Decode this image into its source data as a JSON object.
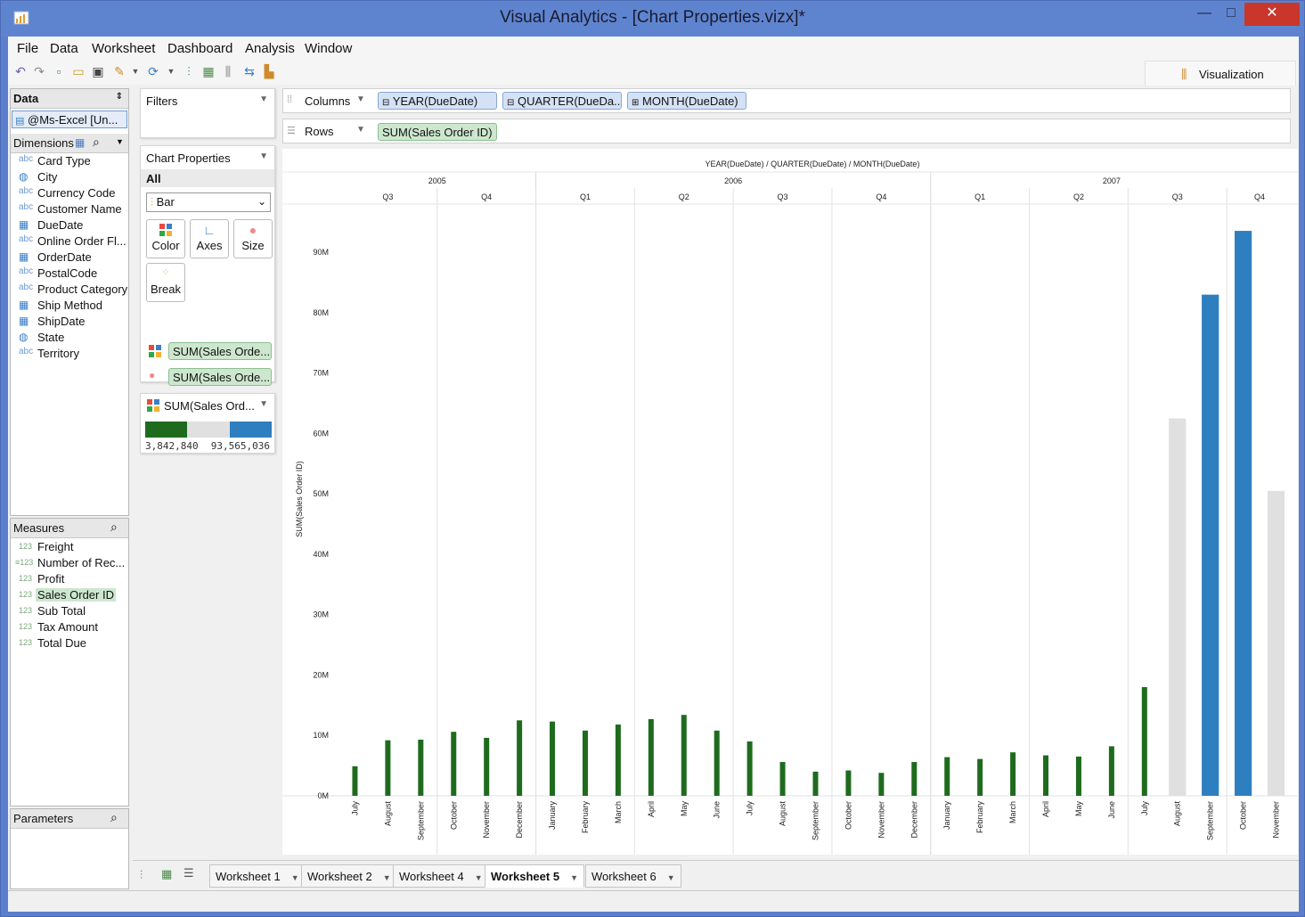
{
  "window": {
    "title": "Visual Analytics - [Chart Properties.vizx]*",
    "min": "—",
    "max": "□",
    "close": "✕"
  },
  "menu": [
    "File",
    "Data",
    "Worksheet",
    "Dashboard",
    "Analysis",
    "Window"
  ],
  "viz_tab": "Visualization",
  "data_panel": {
    "title": "Data",
    "source": "@Ms-Excel [Un...",
    "dimensions_title": "Dimensions",
    "dimensions": [
      {
        "icon": "abc",
        "label": "Card Type"
      },
      {
        "icon": "globe",
        "label": "City"
      },
      {
        "icon": "abc",
        "label": "Currency Code"
      },
      {
        "icon": "abc",
        "label": "Customer Name"
      },
      {
        "icon": "date",
        "label": "DueDate"
      },
      {
        "icon": "abc",
        "label": "Online Order Fl..."
      },
      {
        "icon": "date",
        "label": "OrderDate"
      },
      {
        "icon": "abc",
        "label": "PostalCode"
      },
      {
        "icon": "abc",
        "label": "Product Category"
      },
      {
        "icon": "date",
        "label": "Ship Method"
      },
      {
        "icon": "date",
        "label": "ShipDate"
      },
      {
        "icon": "globe",
        "label": "State"
      },
      {
        "icon": "abc",
        "label": "Territory"
      }
    ],
    "measures_title": "Measures",
    "measures": [
      {
        "icon": "123",
        "label": "Freight"
      },
      {
        "icon": "calc",
        "label": "Number of Rec..."
      },
      {
        "icon": "123",
        "label": "Profit"
      },
      {
        "icon": "123",
        "label": "Sales Order ID",
        "selected": true
      },
      {
        "icon": "123",
        "label": "Sub Total"
      },
      {
        "icon": "123",
        "label": "Tax Amount"
      },
      {
        "icon": "123",
        "label": "Total Due"
      }
    ],
    "parameters_title": "Parameters"
  },
  "filters": {
    "title": "Filters"
  },
  "chart_props": {
    "title": "Chart Properties",
    "all_label": "All",
    "mark_type": "Bar",
    "buttons": {
      "color": "Color",
      "axes": "Axes",
      "size": "Size",
      "break": "Break"
    },
    "pills": [
      "SUM(Sales Orde...",
      "SUM(Sales Orde..."
    ]
  },
  "legend": {
    "title": "SUM(Sales Ord...",
    "min": "3,842,840",
    "max": "93,565,036",
    "colors": [
      "#1e6b1e",
      "#e0e0e0",
      "#2e7fbf"
    ]
  },
  "shelves": {
    "columns_label": "Columns",
    "columns": [
      "YEAR(DueDate)",
      "QUARTER(DueDa...",
      "MONTH(DueDate)"
    ],
    "rows_label": "Rows",
    "rows": [
      "SUM(Sales Order ID)"
    ]
  },
  "sheets": [
    "Worksheet 1",
    "Worksheet 2",
    "Worksheet 4",
    "Worksheet 5",
    "Worksheet 6"
  ],
  "active_sheet": "Worksheet 5",
  "chart_data": {
    "type": "bar",
    "title": "YEAR(DueDate) / QUARTER(DueDate) / MONTH(DueDate)",
    "ylabel": "SUM(Sales Order ID)",
    "ylim": [
      0,
      98000000
    ],
    "yticks": [
      0,
      10000000,
      20000000,
      30000000,
      40000000,
      50000000,
      60000000,
      70000000,
      80000000,
      90000000
    ],
    "ytick_labels": [
      "0M",
      "10M",
      "20M",
      "30M",
      "40M",
      "50M",
      "60M",
      "70M",
      "80M",
      "90M"
    ],
    "years": [
      {
        "label": "2005",
        "span": 6
      },
      {
        "label": "2006",
        "span": 12
      },
      {
        "label": "2007",
        "span": 11
      }
    ],
    "quarters": [
      {
        "label": "Q3",
        "span": 3
      },
      {
        "label": "Q4",
        "span": 3
      },
      {
        "label": "Q1",
        "span": 3
      },
      {
        "label": "Q2",
        "span": 3
      },
      {
        "label": "Q3",
        "span": 3
      },
      {
        "label": "Q4",
        "span": 3
      },
      {
        "label": "Q1",
        "span": 3
      },
      {
        "label": "Q2",
        "span": 3
      },
      {
        "label": "Q3",
        "span": 3
      },
      {
        "label": "Q4",
        "span": 2
      }
    ],
    "categories": [
      "July",
      "August",
      "September",
      "October",
      "November",
      "December",
      "January",
      "February",
      "March",
      "April",
      "May",
      "June",
      "July",
      "August",
      "September",
      "October",
      "November",
      "December",
      "January",
      "February",
      "March",
      "April",
      "May",
      "June",
      "July",
      "August",
      "September",
      "October",
      "November"
    ],
    "values": [
      4900000,
      9200000,
      9300000,
      10600000,
      9600000,
      12500000,
      12300000,
      10800000,
      11800000,
      12700000,
      13400000,
      10800000,
      9000000,
      5600000,
      4000000,
      4200000,
      3800000,
      5600000,
      6400000,
      6100000,
      7200000,
      6700000,
      6500000,
      8200000,
      18000000,
      62500000,
      83000000,
      93565036,
      50500000
    ],
    "colors": [
      "green",
      "green",
      "green",
      "green",
      "green",
      "green",
      "green",
      "green",
      "green",
      "green",
      "green",
      "green",
      "green",
      "green",
      "green",
      "green",
      "green",
      "green",
      "green",
      "green",
      "green",
      "green",
      "green",
      "green",
      "green",
      "grey",
      "blue",
      "blue",
      "grey"
    ],
    "widths": [
      "narrow",
      "narrow",
      "narrow",
      "narrow",
      "narrow",
      "narrow",
      "narrow",
      "narrow",
      "narrow",
      "narrow",
      "narrow",
      "narrow",
      "narrow",
      "narrow",
      "narrow",
      "narrow",
      "narrow",
      "narrow",
      "narrow",
      "narrow",
      "narrow",
      "narrow",
      "narrow",
      "narrow",
      "narrow",
      "wide",
      "wide",
      "wide",
      "wide"
    ],
    "palette": {
      "green": "#1e6b1e",
      "grey": "#e0e0e0",
      "blue": "#2e7fbf"
    }
  }
}
